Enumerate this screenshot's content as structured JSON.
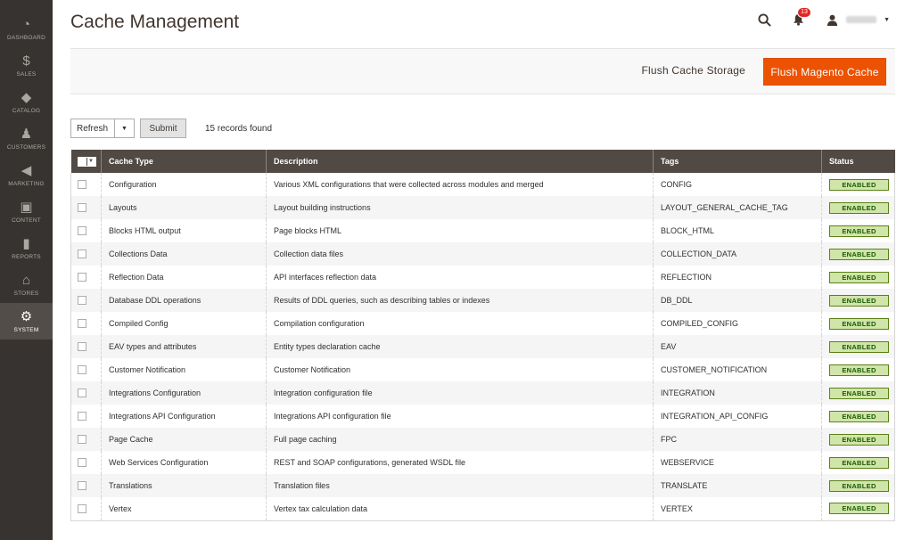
{
  "sidebar": {
    "items": [
      {
        "key": "dashboard",
        "label": "DASHBOARD",
        "icon": "speedometer-icon",
        "glyph": "◔"
      },
      {
        "key": "sales",
        "label": "SALES",
        "icon": "dollar-icon",
        "glyph": "$"
      },
      {
        "key": "catalog",
        "label": "CATALOG",
        "icon": "cube-icon",
        "glyph": "◆"
      },
      {
        "key": "customers",
        "label": "CUSTOMERS",
        "icon": "person-icon",
        "glyph": "♟"
      },
      {
        "key": "marketing",
        "label": "MARKETING",
        "icon": "megaphone-icon",
        "glyph": "◀"
      },
      {
        "key": "content",
        "label": "CONTENT",
        "icon": "layout-icon",
        "glyph": "▣"
      },
      {
        "key": "reports",
        "label": "REPORTS",
        "icon": "bar-chart-icon",
        "glyph": "▮"
      },
      {
        "key": "stores",
        "label": "STORES",
        "icon": "store-icon",
        "glyph": "⌂"
      },
      {
        "key": "system",
        "label": "SYSTEM",
        "icon": "gear-icon",
        "glyph": "⚙",
        "active": true
      }
    ]
  },
  "header": {
    "title": "Cache Management",
    "notifications_count": "13"
  },
  "actions": {
    "flush_storage_label": "Flush Cache Storage",
    "flush_magento_label": "Flush Magento Cache"
  },
  "toolbar": {
    "mass_action_value": "Refresh",
    "submit_label": "Submit",
    "records_found": "15 records found"
  },
  "grid": {
    "columns": [
      "Cache Type",
      "Description",
      "Tags",
      "Status"
    ],
    "rows": [
      {
        "type": "Configuration",
        "description": "Various XML configurations that were collected across modules and merged",
        "tags": "CONFIG",
        "status": "ENABLED"
      },
      {
        "type": "Layouts",
        "description": "Layout building instructions",
        "tags": "LAYOUT_GENERAL_CACHE_TAG",
        "status": "ENABLED"
      },
      {
        "type": "Blocks HTML output",
        "description": "Page blocks HTML",
        "tags": "BLOCK_HTML",
        "status": "ENABLED"
      },
      {
        "type": "Collections Data",
        "description": "Collection data files",
        "tags": "COLLECTION_DATA",
        "status": "ENABLED"
      },
      {
        "type": "Reflection Data",
        "description": "API interfaces reflection data",
        "tags": "REFLECTION",
        "status": "ENABLED"
      },
      {
        "type": "Database DDL operations",
        "description": "Results of DDL queries, such as describing tables or indexes",
        "tags": "DB_DDL",
        "status": "ENABLED"
      },
      {
        "type": "Compiled Config",
        "description": "Compilation configuration",
        "tags": "COMPILED_CONFIG",
        "status": "ENABLED"
      },
      {
        "type": "EAV types and attributes",
        "description": "Entity types declaration cache",
        "tags": "EAV",
        "status": "ENABLED"
      },
      {
        "type": "Customer Notification",
        "description": "Customer Notification",
        "tags": "CUSTOMER_NOTIFICATION",
        "status": "ENABLED"
      },
      {
        "type": "Integrations Configuration",
        "description": "Integration configuration file",
        "tags": "INTEGRATION",
        "status": "ENABLED"
      },
      {
        "type": "Integrations API Configuration",
        "description": "Integrations API configuration file",
        "tags": "INTEGRATION_API_CONFIG",
        "status": "ENABLED"
      },
      {
        "type": "Page Cache",
        "description": "Full page caching",
        "tags": "FPC",
        "status": "ENABLED"
      },
      {
        "type": "Web Services Configuration",
        "description": "REST and SOAP configurations, generated WSDL file",
        "tags": "WEBSERVICE",
        "status": "ENABLED"
      },
      {
        "type": "Translations",
        "description": "Translation files",
        "tags": "TRANSLATE",
        "status": "ENABLED"
      },
      {
        "type": "Vertex",
        "description": "Vertex tax calculation data",
        "tags": "VERTEX",
        "status": "ENABLED"
      }
    ]
  },
  "colors": {
    "accent": "#eb5202",
    "sidebar": "#373330",
    "grid_header": "#514943",
    "status_bg": "#d0e5a9",
    "status_text": "#185b00"
  }
}
